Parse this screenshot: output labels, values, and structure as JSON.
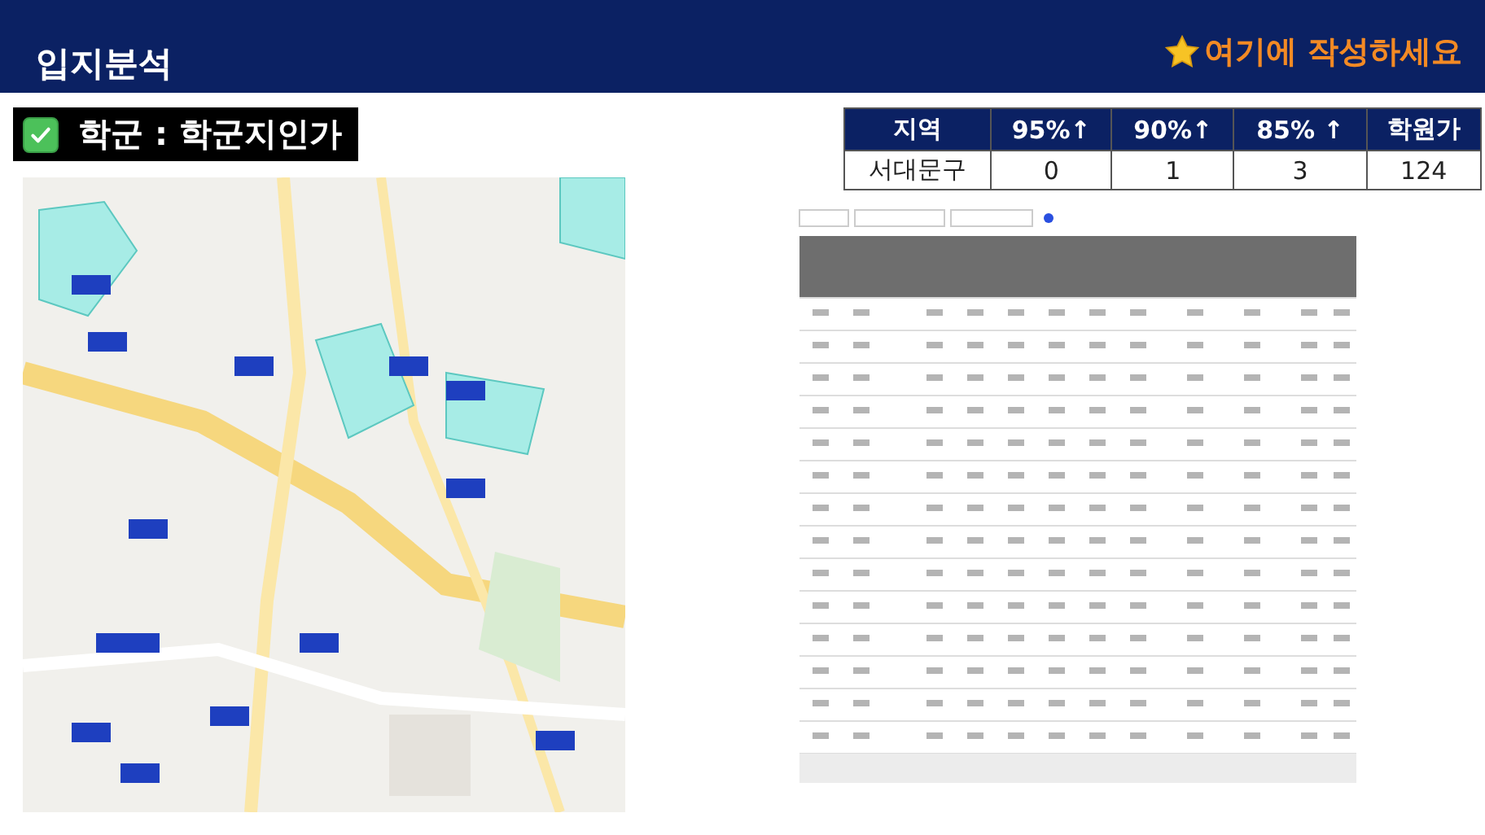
{
  "header": {
    "title": "입지분석",
    "note": "여기에 작성하세요"
  },
  "section": {
    "checked": true,
    "label": "학군 : 학군지인가"
  },
  "summary_table": {
    "columns": [
      "지역",
      "95%↑",
      "90%↑",
      "85% ↑",
      "학원가"
    ],
    "rows": [
      [
        "서대문구",
        "0",
        "1",
        "3",
        "124"
      ]
    ]
  }
}
